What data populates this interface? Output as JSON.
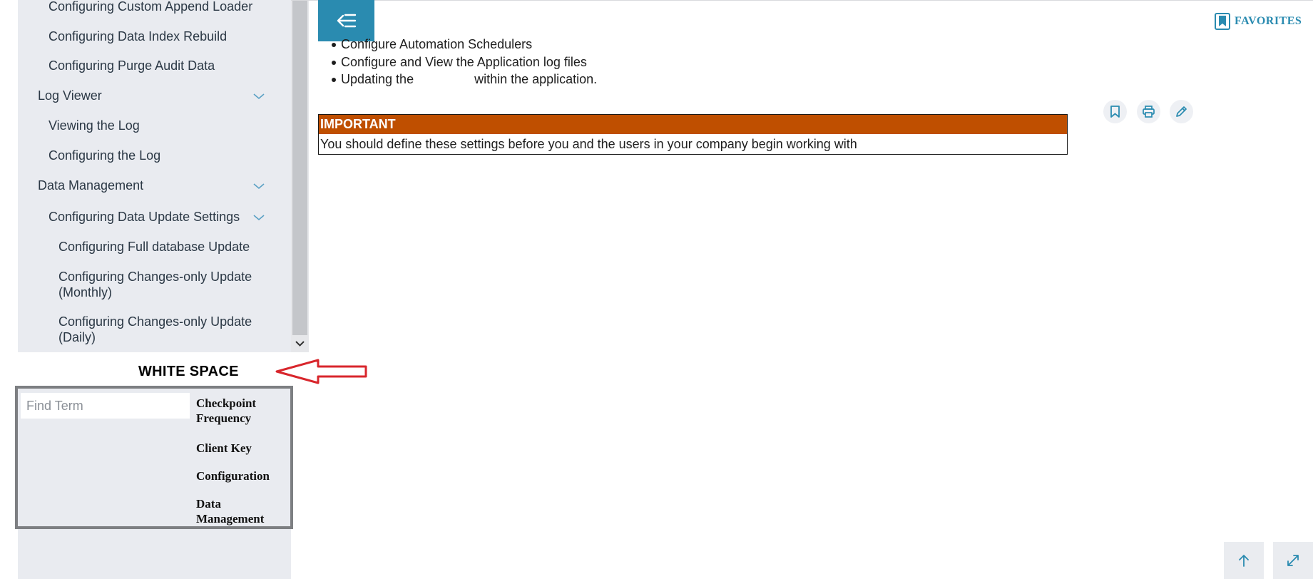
{
  "sidebar": {
    "items": [
      {
        "label": "Configuring Custom Append Loader"
      },
      {
        "label": "Configuring Data Index Rebuild"
      },
      {
        "label": "Configuring Purge Audit Data"
      },
      {
        "label": "Log Viewer"
      },
      {
        "label": "Viewing the Log"
      },
      {
        "label": "Configuring the Log"
      },
      {
        "label": "Data Management"
      },
      {
        "label": "Configuring Data Update Settings"
      },
      {
        "label": "Configuring Full database Update"
      },
      {
        "label": "Configuring Changes-only Update (Monthly)"
      },
      {
        "label": "Configuring Changes-only Update (Daily)"
      }
    ]
  },
  "annotation": {
    "label": "WHITE SPACE",
    "arrow_color": "#d8262c"
  },
  "glossary": {
    "search_placeholder": "Find Term",
    "terms": [
      {
        "label": "Checkpoint Frequency"
      },
      {
        "label": "Client Key"
      },
      {
        "label": "Configuration"
      },
      {
        "label": "Data Management"
      }
    ]
  },
  "header": {
    "back_icon": "collapse-menu-icon",
    "favorites_label": "FAVORITES",
    "favorites_icon": "bookmark-icon"
  },
  "content": {
    "bullets": [
      {
        "text": "Configure Automation Schedulers"
      },
      {
        "text": "Configure and View the Application log files"
      },
      {
        "pre": "Updating the",
        "post": "within the application."
      }
    ],
    "important": {
      "heading": "IMPORTANT",
      "body": "You should define these settings before you and the users in your company begin working with"
    },
    "actions": [
      "bookmark-icon",
      "print-icon",
      "edit-icon"
    ]
  },
  "footer": {
    "actions": [
      "arrow-up-icon",
      "expand-icon"
    ]
  },
  "colors": {
    "accent": "#2a8bb0",
    "important": "#bf4f00",
    "sidebar_bg": "#e9ebf0"
  }
}
